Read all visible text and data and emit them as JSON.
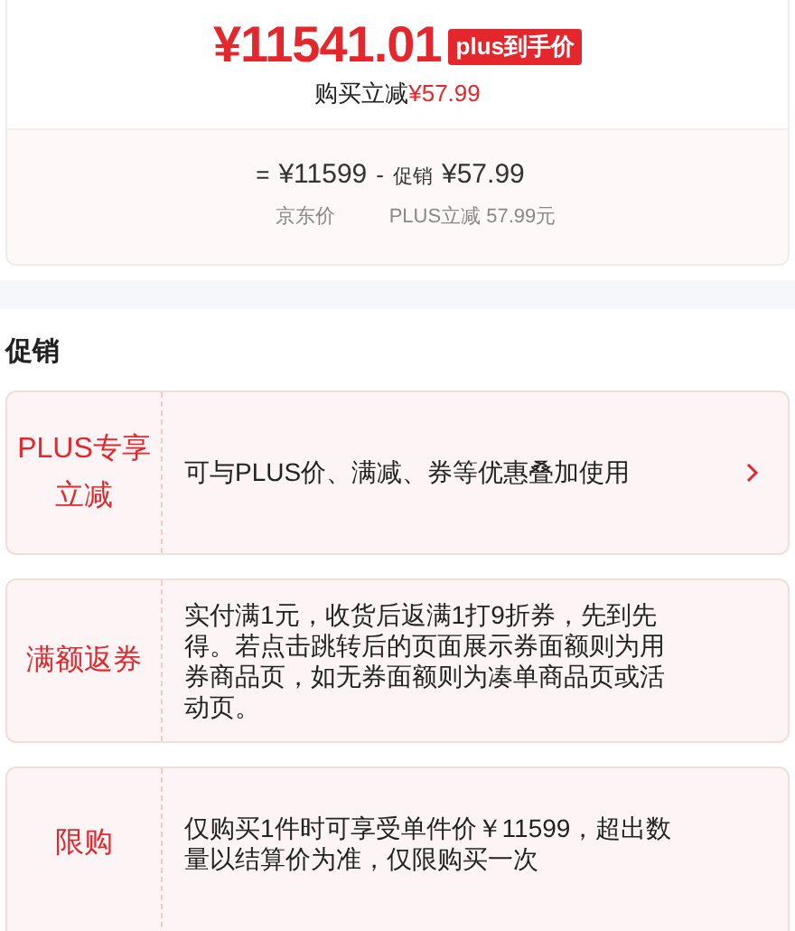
{
  "price_card": {
    "final_price": "¥11541.01",
    "badge": "plus到手价",
    "discount_label": "购买立减",
    "discount_value": "¥57.99",
    "breakdown": {
      "equals": "=",
      "base_price": "¥11599",
      "minus": "-",
      "promo_label": "促销",
      "promo_value": "¥57.99",
      "base_caption": "京东价",
      "promo_caption": "PLUS立减 57.99元"
    }
  },
  "promotions": {
    "title": "促销",
    "items": [
      {
        "tag": "PLUS专享立减",
        "text": "可与PLUS价、满减、券等优惠叠加使用",
        "link": true
      },
      {
        "tag": "满额返券",
        "text": "实付满1元，收货后返满1打9折券，先到先得。若点击跳转后的页面展示券面额则为用券商品页，如无券面额则为凑单商品页或活动页。",
        "link": false
      },
      {
        "tag": "限购",
        "text": "仅购买1件时可享受单件价￥11599，超出数量以结算价为准，仅限购买一次",
        "link": false
      }
    ]
  }
}
